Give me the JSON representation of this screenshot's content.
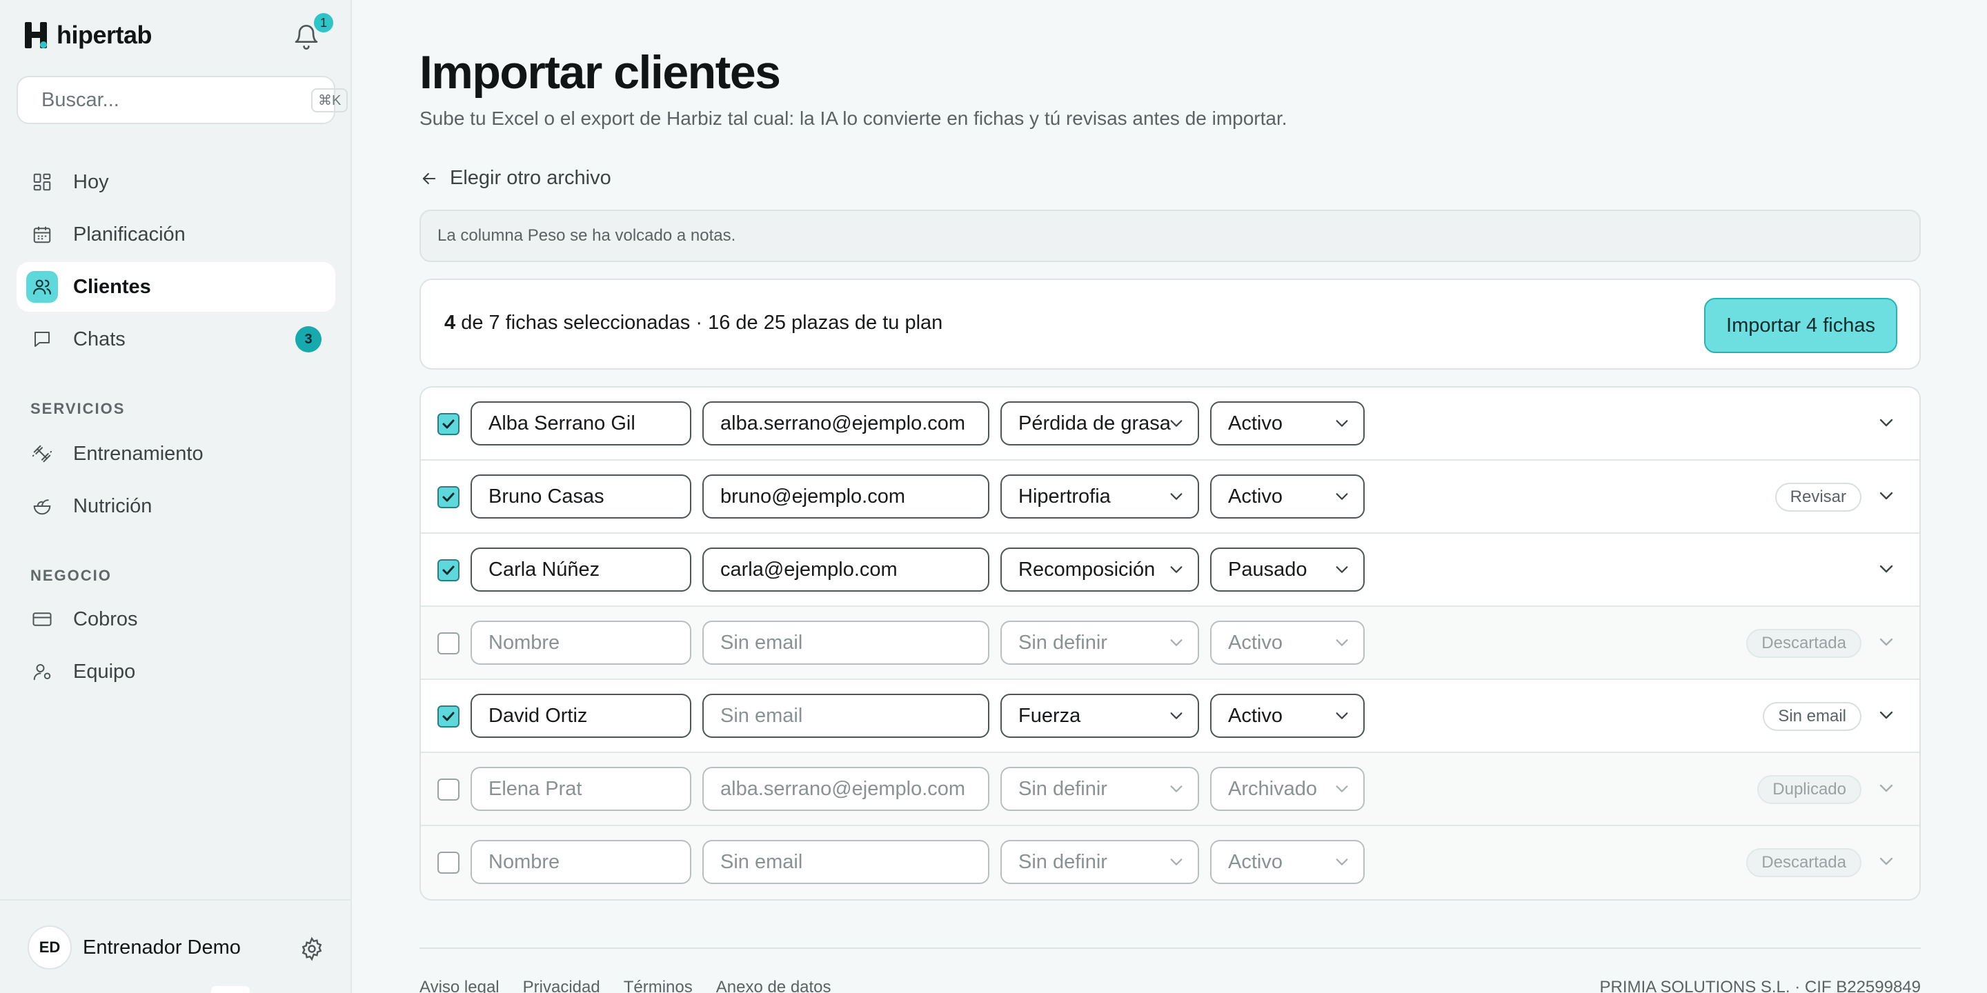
{
  "app": {
    "brand": "hipertab",
    "notifications_count": "1",
    "accent_color": "#5ed8db"
  },
  "search": {
    "placeholder": "Buscar...",
    "shortcut": "⌘K"
  },
  "sidebar": {
    "main_items": [
      {
        "label": "Hoy",
        "icon": "dashboard-icon"
      },
      {
        "label": "Planificación",
        "icon": "calendar-icon"
      },
      {
        "label": "Clientes",
        "icon": "users-icon",
        "active": true
      },
      {
        "label": "Chats",
        "icon": "chat-icon",
        "count": "3"
      }
    ],
    "services_label": "SERVICIOS",
    "services_items": [
      {
        "label": "Entrenamiento",
        "icon": "dumbbell-icon"
      },
      {
        "label": "Nutrición",
        "icon": "salad-icon"
      }
    ],
    "business_label": "NEGOCIO",
    "business_items": [
      {
        "label": "Cobros",
        "icon": "credit-card-icon"
      },
      {
        "label": "Equipo",
        "icon": "team-icon"
      }
    ],
    "user": {
      "initials": "ED",
      "name": "Entrenador Demo"
    }
  },
  "page": {
    "title": "Importar clientes",
    "subtitle": "Sube tu Excel o el export de Harbiz tal cual: la IA lo convierte en fichas y tú revisas antes de importar.",
    "back_label": "Elegir otro archivo",
    "notice": "La columna Peso se ha volcado a notas."
  },
  "summary": {
    "selected": "4",
    "text_a": " de 7 fichas seleccionadas",
    "separator": "·",
    "text_b": "16 de 25 plazas de tu plan",
    "import_button": "Importar 4 fichas"
  },
  "rows": [
    {
      "checked": true,
      "name": "Alba Serrano Gil",
      "email": "alba.serrano@ejemplo.com",
      "goal": "Pérdida de grasa",
      "status": "Activo",
      "tag": ""
    },
    {
      "checked": true,
      "name": "Bruno Casas",
      "email": "bruno@ejemplo.com",
      "goal": "Hipertrofia",
      "status": "Activo",
      "tag": "Revisar"
    },
    {
      "checked": true,
      "name": "Carla Núñez",
      "email": "carla@ejemplo.com",
      "goal": "Recomposición",
      "status": "Pausado",
      "tag": ""
    },
    {
      "checked": false,
      "name": "",
      "name_placeholder": "Nombre",
      "email": "",
      "email_placeholder": "Sin email",
      "goal": "Sin definir",
      "status": "Activo",
      "tag": "Descartada"
    },
    {
      "checked": true,
      "name": "David Ortiz",
      "email": "",
      "email_placeholder": "Sin email",
      "goal": "Fuerza",
      "status": "Activo",
      "tag": "Sin email"
    },
    {
      "checked": false,
      "name": "Elena Prat",
      "email": "alba.serrano@ejemplo.com",
      "goal": "Sin definir",
      "status": "Archivado",
      "tag": "Duplicado"
    },
    {
      "checked": false,
      "name": "",
      "name_placeholder": "Nombre",
      "email": "",
      "email_placeholder": "Sin email",
      "goal": "Sin definir",
      "status": "Activo",
      "tag": "Descartada"
    }
  ],
  "footer": {
    "links": [
      "Aviso legal",
      "Privacidad",
      "Términos",
      "Anexo de datos"
    ],
    "company": "PRIMIA SOLUTIONS S.L. · CIF B22599849"
  }
}
